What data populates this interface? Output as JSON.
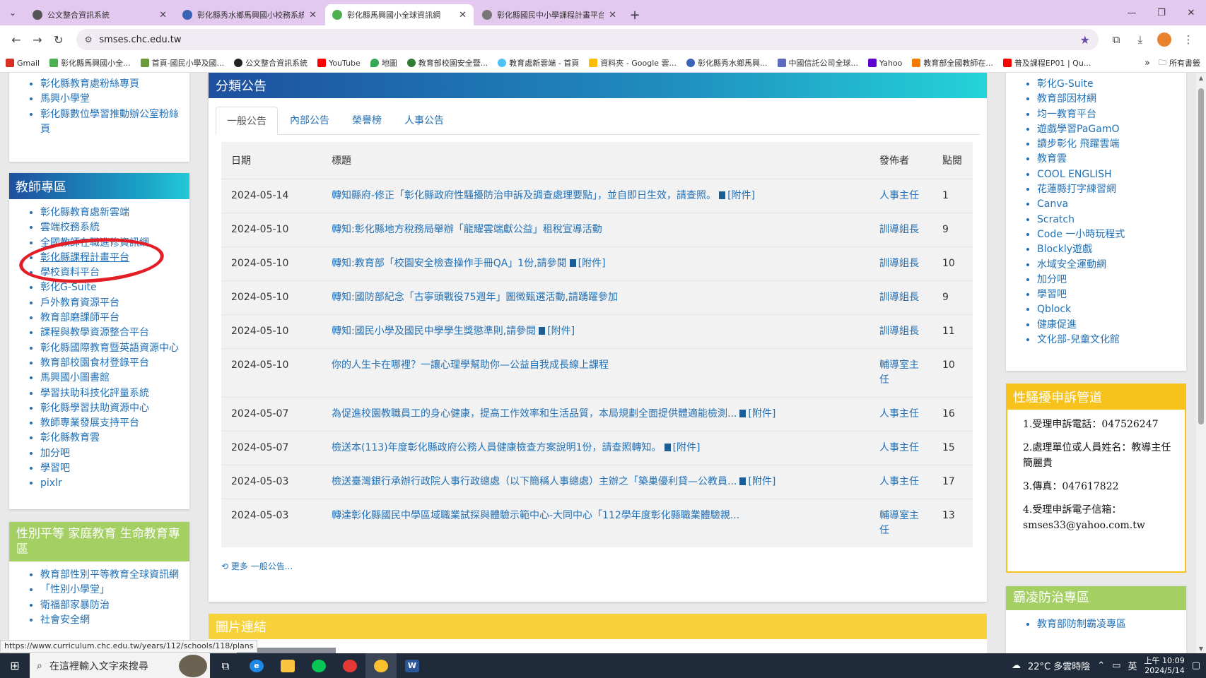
{
  "browser": {
    "tabs": [
      {
        "title": "公文整合資訊系統",
        "active": false
      },
      {
        "title": "彰化縣秀水鄉馬興國小校務系統",
        "active": false
      },
      {
        "title": "彰化縣馬興國小全球資訊網",
        "active": true
      },
      {
        "title": "彰化縣國民中小學課程計畫平台",
        "active": false
      }
    ],
    "url": "smses.chc.edu.tw",
    "bookmarks": [
      "Gmail",
      "彰化縣馬興國小全...",
      "首頁-國民小學及國...",
      "公文整合資訊系統",
      "YouTube",
      "地圖",
      "教育部校園安全暨...",
      "教育處新雲端 - 首頁",
      "資料夾 - Google 雲...",
      "彰化縣秀水鄉馬興...",
      "中國信託公司全球...",
      "Yahoo",
      "教育部全國教師在...",
      "普及課程EP01 | Qu..."
    ],
    "all_bookmarks": "所有書籤"
  },
  "left_top_links": [
    "彰化縣教育處粉絲專頁",
    "馬興小學堂",
    "彰化縣數位學習推動辦公室粉絲頁"
  ],
  "teacher_zone": {
    "title": "教師專區",
    "links": [
      "彰化縣教育處新雲端",
      "雲端校務系統",
      "全國教師在職進修資訊網",
      "彰化縣課程計畫平台",
      "學校資料平台",
      "彰化G-Suite",
      "戶外教育資源平台",
      "教育部磨課師平台",
      "課程與教學資源整合平台",
      "彰化縣國際教育暨英語資源中心",
      "教育部校園食材登錄平台",
      "馬興國小圖書館",
      "學習扶助科技化評量系統",
      "彰化縣學習扶助資源中心",
      "教師專業發展支持平台",
      "彰化縣教育雲",
      "加分吧",
      "學習吧",
      "pixlr"
    ]
  },
  "gender_zone": {
    "title": "性別平等 家庭教育 生命教育專區",
    "links": [
      "教育部性別平等教育全球資訊網",
      "「性別小學堂」",
      "衛福部家暴防治",
      "社會安全網"
    ]
  },
  "announcements": {
    "title": "分類公告",
    "tabs": [
      "一般公告",
      "內部公告",
      "榮譽榜",
      "人事公告"
    ],
    "columns": {
      "date": "日期",
      "title": "標題",
      "publisher": "發佈者",
      "views": "點閱"
    },
    "attachment_label": "[附件]",
    "rows": [
      {
        "date": "2024-05-14",
        "title": "轉知縣府-修正「彰化縣政府性騷擾防治申訴及調查處理要點」，並自即日生效，請查照。",
        "attachment": true,
        "publisher": "人事主任",
        "views": "1"
      },
      {
        "date": "2024-05-10",
        "title": "轉知:彰化縣地方稅務局舉辦「龍耀雲端獻公益」租稅宣導活動",
        "attachment": false,
        "publisher": "訓導組長",
        "views": "9"
      },
      {
        "date": "2024-05-10",
        "title": "轉知:教育部「校園安全檢查操作手冊QA」1份,請參閱",
        "attachment": true,
        "publisher": "訓導組長",
        "views": "10"
      },
      {
        "date": "2024-05-10",
        "title": "轉知:國防部紀念「古寧頭戰役75週年」圖徵甄選活動,請踴躍參加",
        "attachment": false,
        "publisher": "訓導組長",
        "views": "9"
      },
      {
        "date": "2024-05-10",
        "title": "轉知:國民小學及國民中學學生獎懲準則,請參閱",
        "attachment": true,
        "publisher": "訓導組長",
        "views": "11"
      },
      {
        "date": "2024-05-10",
        "title": "你的人生卡在哪裡？一讓心理學幫助你—公益自我成長線上課程",
        "attachment": false,
        "publisher": "輔導室主任",
        "views": "10"
      },
      {
        "date": "2024-05-07",
        "title": "為促進校園教職員工的身心健康，提高工作效率和生活品質，本局規劃全面提供體適能檢測...",
        "attachment": true,
        "publisher": "人事主任",
        "views": "16"
      },
      {
        "date": "2024-05-07",
        "title": "檢送本(113)年度彰化縣政府公務人員健康檢查方案說明1份，請查照轉知。",
        "attachment": true,
        "publisher": "人事主任",
        "views": "15"
      },
      {
        "date": "2024-05-03",
        "title": "檢送臺灣銀行承辦行政院人事行政總處（以下簡稱人事總處）主辦之「築巢優利貸—公教員...",
        "attachment": true,
        "publisher": "人事主任",
        "views": "17"
      },
      {
        "date": "2024-05-03",
        "title": "轉達彰化縣國民中學區域職業試探與體驗示範中心-大同中心「112學年度彰化縣職業體驗親...",
        "attachment": false,
        "publisher": "輔導室主任",
        "views": "13"
      }
    ],
    "more_link": "更多 一般公告..."
  },
  "picture_links": {
    "title": "圖片連結"
  },
  "right_links": [
    "彰化G-Suite",
    "教育部因材網",
    "均一教育平台",
    "遊戲學習PaGamO",
    "讀步彰化 飛躍雲端",
    "教育雲",
    "COOL ENGLISH",
    "花蓮縣打字練習網",
    "Canva",
    "Scratch",
    "Code 一小時玩程式",
    "Blockly遊戲",
    "水域安全運動網",
    "加分吧",
    "學習吧",
    "Qblock",
    "健康促進",
    "文化部-兒童文化館"
  ],
  "harassment": {
    "title": "性騷擾申訴管道",
    "lines": [
      "1.受理申訴電話：047526247",
      "2.處理單位或人員姓名：教導主任簡麗貴",
      "3.傳真：047617822",
      "4.受理申訴電子信箱：smses33@yahoo.com.tw"
    ]
  },
  "bullying": {
    "title": "霸凌防治專區",
    "links": [
      "教育部防制霸凌專區"
    ]
  },
  "status_url": "https://www.curriculum.chc.edu.tw/years/112/schools/118/plans",
  "taskbar": {
    "search_placeholder": "在這裡輸入文字來搜尋",
    "weather": "22°C  多雲時陰",
    "ime": "英",
    "time": "上午 10:09",
    "date": "2024/5/14"
  }
}
